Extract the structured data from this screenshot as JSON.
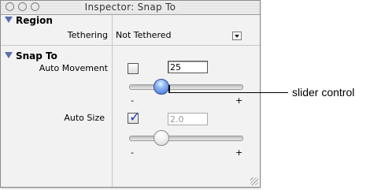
{
  "window": {
    "title": "Inspector: Snap To"
  },
  "region": {
    "header": "Region",
    "tethering_label": "Tethering",
    "tethering_value": "Not Tethered"
  },
  "snap_to": {
    "header": "Snap To",
    "auto_movement": {
      "label": "Auto Movement",
      "checked": false,
      "value": "25",
      "slider_min_label": "-",
      "slider_max_label": "+"
    },
    "auto_size": {
      "label": "Auto Size",
      "checked": true,
      "value": "2.0",
      "slider_min_label": "-",
      "slider_max_label": "+"
    }
  },
  "annotation": {
    "callout": "slider control"
  },
  "colors": {
    "disclosure": "#5a6fa8",
    "checkmark": "#1f3fb8",
    "active_thumb": "#3a6ed3"
  }
}
